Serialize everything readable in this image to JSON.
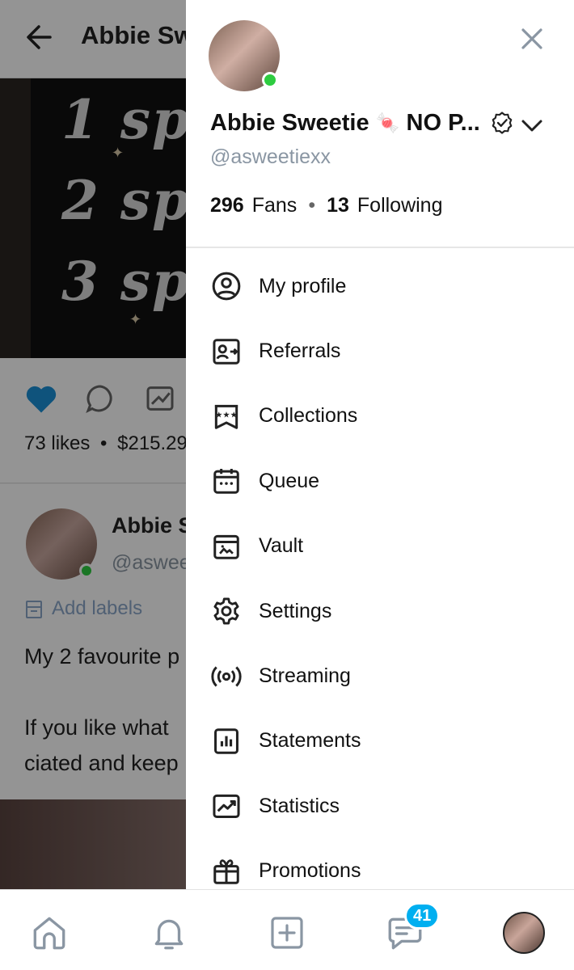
{
  "background": {
    "title": "Abbie Sw",
    "media_lines": [
      "1 sp",
      "2 sp",
      "3 sp"
    ],
    "likes_text": "73 likes",
    "likes_sep": "•",
    "amount_text": "$215.29",
    "post_author": "Abbie S",
    "post_handle": "@aswee",
    "add_labels": "Add labels",
    "post_line1": "My 2 favourite p",
    "post_line2": "If you like what",
    "post_line3": "ciated and keep"
  },
  "drawer": {
    "name": "Abbie Sweetie",
    "name_emoji": "🍬",
    "name_suffix": "NO P...",
    "handle": "@asweetiexx",
    "fans_count": "296",
    "fans_label": "Fans",
    "stats_sep": "•",
    "following_count": "13",
    "following_label": "Following",
    "menu": [
      {
        "label": "My profile",
        "icon": "user-circle-icon"
      },
      {
        "label": "Referrals",
        "icon": "referrals-icon"
      },
      {
        "label": "Collections",
        "icon": "collections-icon"
      },
      {
        "label": "Queue",
        "icon": "calendar-icon"
      },
      {
        "label": "Vault",
        "icon": "vault-icon"
      },
      {
        "label": "Settings",
        "icon": "gear-icon"
      },
      {
        "label": "Streaming",
        "icon": "broadcast-icon"
      },
      {
        "label": "Statements",
        "icon": "statements-icon"
      },
      {
        "label": "Statistics",
        "icon": "statistics-icon"
      },
      {
        "label": "Promotions",
        "icon": "gift-icon"
      }
    ]
  },
  "bottom_nav": {
    "messages_badge": "41",
    "items": [
      "home-icon",
      "bell-icon",
      "add-post-icon",
      "messages-icon",
      "profile-avatar"
    ]
  },
  "colors": {
    "accent": "#00aff0",
    "online": "#2ecc40",
    "muted": "#8a96a3"
  }
}
